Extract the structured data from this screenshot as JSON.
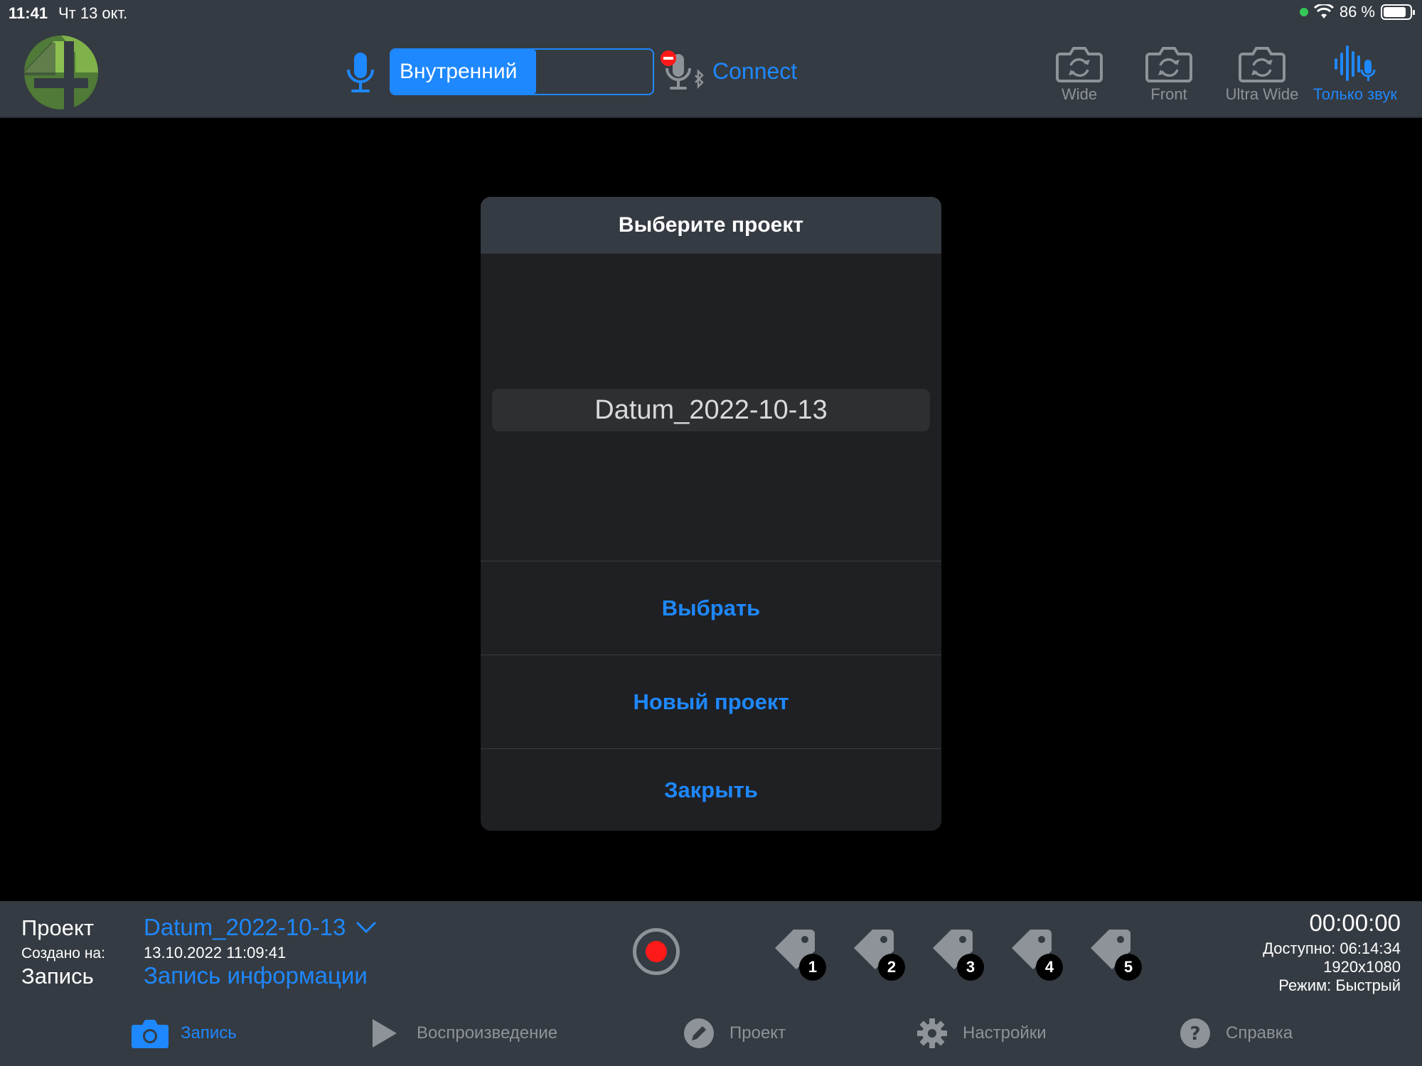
{
  "status_bar": {
    "time": "11:41",
    "date": "Чт 13 окт.",
    "battery": "86 %"
  },
  "toolbar": {
    "audio_source": "Внутренний",
    "connect_label": "Connect",
    "cameras": [
      {
        "label": "Wide"
      },
      {
        "label": "Front"
      },
      {
        "label": "Ultra Wide"
      },
      {
        "label": "Только звук"
      }
    ]
  },
  "dialog": {
    "title": "Выберите проект",
    "selected_project": "Datum_2022-10-13",
    "buttons": {
      "select": "Выбрать",
      "new_project": "Новый проект",
      "close": "Закрыть"
    }
  },
  "bottom_panel": {
    "project_label": "Проект",
    "project_value": "Datum_2022-10-13",
    "created_label": "Создано на:",
    "created_value": "13.10.2022 11:09:41",
    "record_label": "Запись",
    "record_value": "Запись информации",
    "tags": [
      "1",
      "2",
      "3",
      "4",
      "5"
    ],
    "timer": "00:00:00",
    "available": "Доступно: 06:14:34",
    "resolution": "1920x1080",
    "mode": "Режим: Быстрый"
  },
  "tabs": [
    {
      "label": "Запись"
    },
    {
      "label": "Воспроизведение"
    },
    {
      "label": "Проект"
    },
    {
      "label": "Настройки"
    },
    {
      "label": "Справка"
    }
  ],
  "colors": {
    "accent": "#1e88ff",
    "bar_bg": "#353b42",
    "record": "#ff1a1a"
  }
}
